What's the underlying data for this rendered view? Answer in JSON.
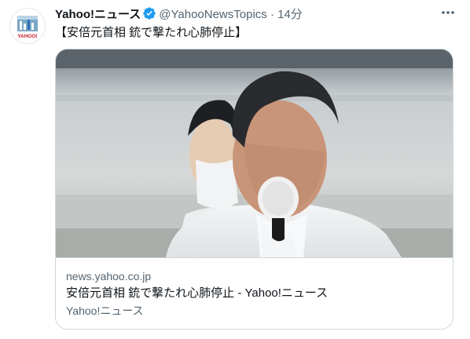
{
  "tweet": {
    "author_name": "Yahoo!ニュース",
    "author_handle": "@YahooNewsTopics",
    "separator": "·",
    "time": "14分",
    "text": "【安倍元首相 銃で撃たれ心肺停止】",
    "more_icon": "more-icon",
    "verified_icon": "verified-badge-icon",
    "verified_color": "#1d9bf0"
  },
  "avatar": {
    "logo_text": "YAHOO!",
    "icon": "yahoo-news-logo"
  },
  "card": {
    "domain": "news.yahoo.co.jp",
    "title": "安倍元首相 銃で撃たれ心肺停止 - Yahoo!ニュース",
    "source": "Yahoo!ニュース"
  }
}
